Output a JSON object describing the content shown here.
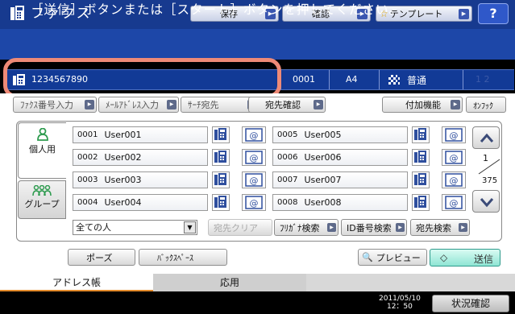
{
  "header": {
    "title": "ファクス",
    "save_label": "保存",
    "confirm_label": "確認",
    "template_label": "テンプレート",
    "help_label": "?"
  },
  "message": "［送信］ボタンまたは［スタート］ボタンを押してください。",
  "destination": {
    "number": "1234567890",
    "count": "0001",
    "paper_size": "A4",
    "mode": "普通",
    "line_indicator": "1 2"
  },
  "toolbar": {
    "btn1": "ﾌｧｸｽ番号入力",
    "btn2": "ﾒｰﾙｱﾄﾞﾚｽ入力",
    "btn3": "ｻｰﾁ宛先",
    "dest_confirm": "宛先確認",
    "extra": "付加機能",
    "onhook": "ｵﾝﾌｯｸ"
  },
  "tabs": {
    "person": "個人用",
    "group": "グループ"
  },
  "entries": [
    {
      "id": "0001",
      "name": "User001"
    },
    {
      "id": "0002",
      "name": "User002"
    },
    {
      "id": "0003",
      "name": "User003"
    },
    {
      "id": "0004",
      "name": "User004"
    },
    {
      "id": "0005",
      "name": "User005"
    },
    {
      "id": "0006",
      "name": "User006"
    },
    {
      "id": "0007",
      "name": "User007"
    },
    {
      "id": "0008",
      "name": "User008"
    }
  ],
  "pager": {
    "current": "1",
    "total": "375"
  },
  "filter": {
    "value": "全ての人"
  },
  "actions": {
    "clear": "宛先クリア",
    "kana_search": "ﾌﾘｶﾞﾅ検索",
    "id_search": "ID番号検索",
    "dest_search": "宛先検索",
    "pause": "ポーズ",
    "backspace": "ﾊﾞｯｸｽﾍﾟｰｽ",
    "preview": "プレビュー",
    "send": "送信"
  },
  "bottom_tabs": {
    "address_book": "アドレス帳",
    "application": "応用"
  },
  "status": {
    "date": "2011/05/10",
    "time": "12：50",
    "status_label": "状況確認"
  },
  "colors": {
    "header_bg": "#173a8f",
    "message_bg": "#1d47a8",
    "highlight": "#ee8a77",
    "send_accent": "#8fe5d4"
  }
}
